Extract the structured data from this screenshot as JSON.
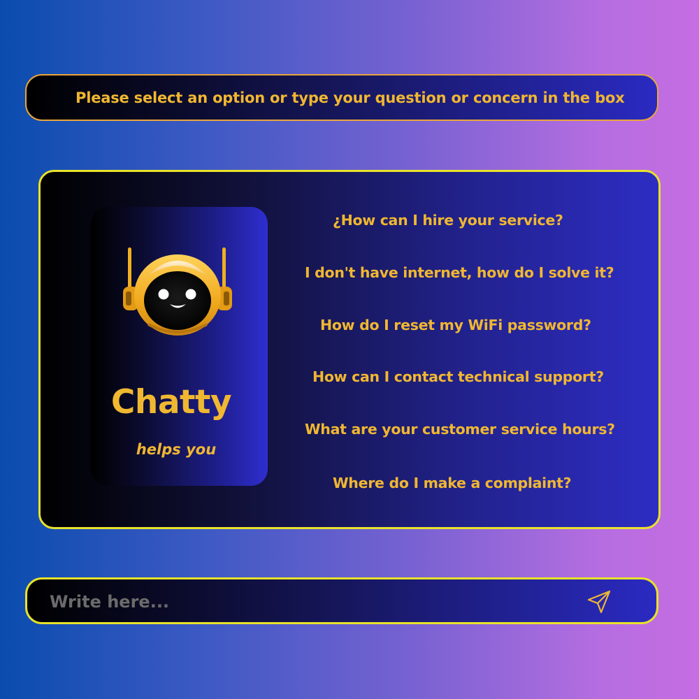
{
  "banner": {
    "text": "Please select an option or type your question or concern in the box"
  },
  "bot": {
    "icon": "robot-icon",
    "name": "Chatty",
    "tagline": "helps you"
  },
  "options": [
    {
      "label": "¿How can I hire your service?"
    },
    {
      "label": "I don't have internet, how do I solve it?"
    },
    {
      "label": "How do I reset my WiFi password?"
    },
    {
      "label": "How can I contact technical support?"
    },
    {
      "label": "What are your customer service hours?"
    },
    {
      "label": "Where do I make a complaint?"
    }
  ],
  "input": {
    "placeholder": "Write here...",
    "value": ""
  },
  "send": {
    "icon": "send-icon"
  },
  "colors": {
    "accent_text": "#f0b731",
    "border_yellow": "#e8e22b",
    "border_orange": "#e9a53b",
    "panel_blue": "#2d2dc4"
  }
}
